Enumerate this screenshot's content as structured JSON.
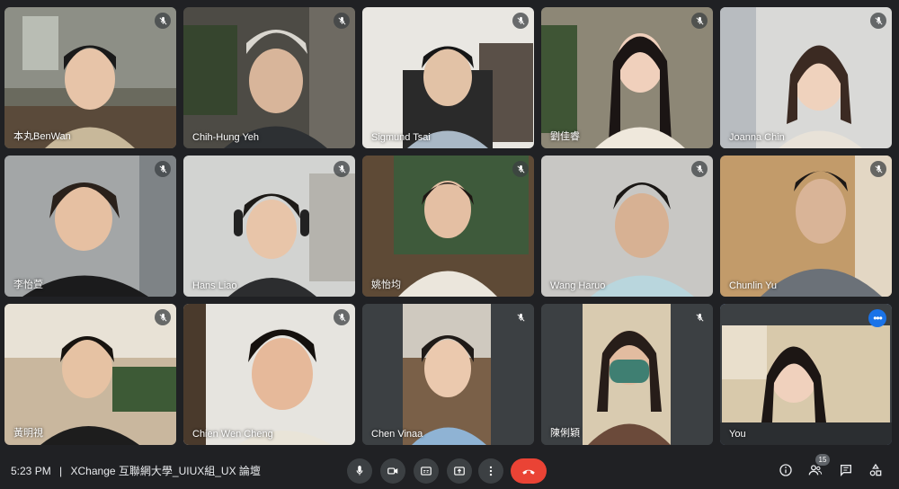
{
  "meeting": {
    "time": "5:23 PM",
    "separator": "|",
    "title": "XChange 互聯網大學_UIUX組_UX 論壇"
  },
  "participants": [
    {
      "name": "本丸BenWan",
      "muted": true
    },
    {
      "name": "Chih-Hung Yeh",
      "muted": true
    },
    {
      "name": "Sigmund Tsai",
      "muted": true
    },
    {
      "name": "劉佳睿",
      "muted": true
    },
    {
      "name": "Joanna Chin",
      "muted": true
    },
    {
      "name": "李怡萱",
      "muted": true
    },
    {
      "name": "Hans Liao",
      "muted": true
    },
    {
      "name": "姚怡均",
      "muted": true
    },
    {
      "name": "Wang Haruo",
      "muted": true
    },
    {
      "name": "Chunlin Yu",
      "muted": true
    },
    {
      "name": "黃明視",
      "muted": true
    },
    {
      "name": "Chien Wen Cheng",
      "muted": true
    },
    {
      "name": "Chen Vinaa",
      "muted": true
    },
    {
      "name": "陳俐穎",
      "muted": true
    },
    {
      "name": "You",
      "muted": false
    }
  ],
  "controls": {
    "people_count": "15",
    "icons": [
      "mic-icon",
      "camera-icon",
      "captions-icon",
      "present-icon",
      "more-vert-icon",
      "hang-up-icon"
    ],
    "right_icons": [
      "info-icon",
      "people-icon",
      "chat-icon",
      "activities-icon"
    ]
  },
  "colors": {
    "background": "#202124",
    "tile": "#3c4043",
    "hangup": "#ea4335",
    "self_outline": "#8ab4f8",
    "more_button": "#1a73e8"
  }
}
